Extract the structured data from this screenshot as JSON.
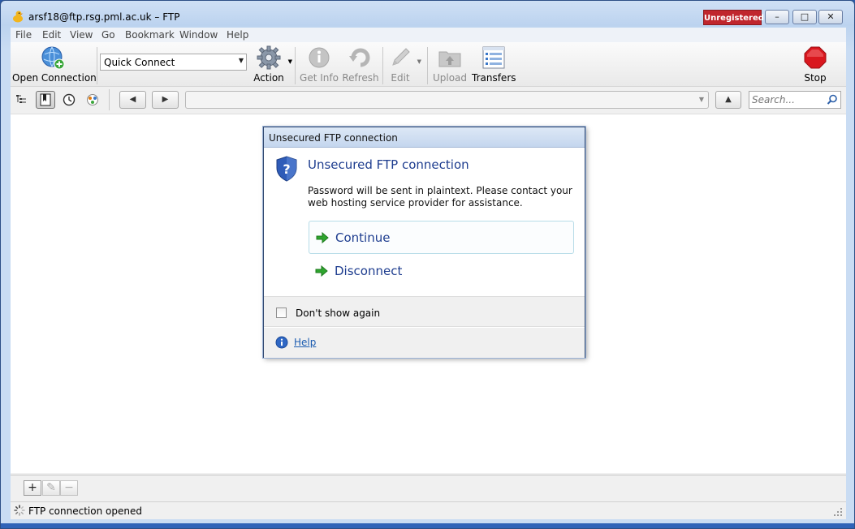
{
  "window": {
    "title": "arsf18@ftp.rsg.pml.ac.uk – FTP",
    "badge": "Unregistered",
    "controls": {
      "minimize": "–",
      "maximize": "□",
      "close": "✕"
    }
  },
  "menu": [
    "File",
    "Edit",
    "View",
    "Go",
    "Bookmark",
    "Window",
    "Help"
  ],
  "toolbar": {
    "open_connection": "Open Connection",
    "quick_connect": "Quick Connect",
    "action": "Action",
    "get_info": "Get Info",
    "refresh": "Refresh",
    "edit": "Edit",
    "upload": "Upload",
    "transfers": "Transfers",
    "stop": "Stop"
  },
  "navigation": {
    "back": "◀",
    "forward": "▶",
    "up": "▲",
    "path_value": "",
    "search_placeholder": "Search..."
  },
  "bottom_buttons": {
    "add": "+",
    "edit": "✎",
    "remove": "−"
  },
  "status": {
    "text": "FTP connection opened"
  },
  "dialog": {
    "title": "Unsecured FTP connection",
    "heading": "Unsecured FTP connection",
    "message": "Password will be sent in plaintext. Please contact your web hosting service provider for assistance.",
    "options": [
      {
        "label": "Continue"
      },
      {
        "label": "Disconnect"
      }
    ],
    "checkbox_label": "Don't show again",
    "checkbox_checked": false,
    "help_link": "Help"
  },
  "colors": {
    "badge": "#c0262d",
    "dialog_heading": "#1e3d8f",
    "link": "#1a5bb0",
    "stop": "#d9171e",
    "arrow_green": "#2ea52e"
  }
}
